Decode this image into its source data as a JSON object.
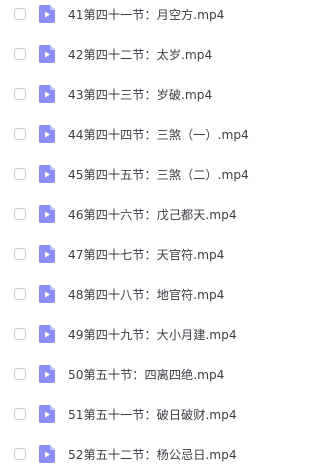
{
  "colors": {
    "video_icon_bg": "#8b8ef5",
    "video_icon_fold": "#c3c5fb",
    "text": "#3b3f45",
    "checkbox_border": "#c9ccd1"
  },
  "icon": "video-file-icon",
  "files": [
    {
      "name": "41第四十一节：月空方.mp4"
    },
    {
      "name": "42第四十二节：太岁.mp4"
    },
    {
      "name": "43第四十三节：岁破.mp4"
    },
    {
      "name": "44第四十四节：三煞（一）.mp4"
    },
    {
      "name": "45第四十五节：三煞（二）.mp4"
    },
    {
      "name": "46第四十六节：戊己都天.mp4"
    },
    {
      "name": "47第四十七节：天官符.mp4"
    },
    {
      "name": "48第四十八节：地官符.mp4"
    },
    {
      "name": "49第四十九节：大小月建.mp4"
    },
    {
      "name": "50第五十节：四离四绝.mp4"
    },
    {
      "name": "51第五十一节：破日破财.mp4"
    },
    {
      "name": "52第五十二节：杨公忌日.mp4"
    }
  ]
}
